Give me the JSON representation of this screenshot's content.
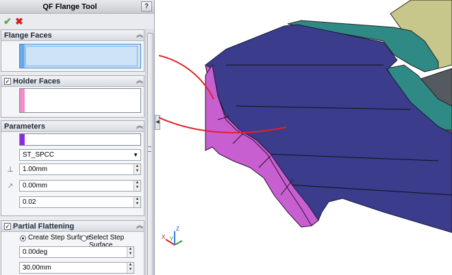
{
  "panel": {
    "title": "QF Flange Tool",
    "help_label": "?",
    "ok_icon": "checkmark-icon",
    "cancel_icon": "x-icon"
  },
  "groups": {
    "flange_faces": {
      "title": "Flange Faces",
      "swatch_color": "#6aa8e8",
      "selected": true
    },
    "holder_faces": {
      "title": "Holder Faces",
      "checked": true,
      "swatch_color": "#f08cc8"
    },
    "parameters": {
      "title": "Parameters",
      "color_swatch": "#8a2be2",
      "material": "ST_SPCC",
      "thickness": "1.00mm",
      "offset": "0.00mm",
      "k_factor": "0.02",
      "thickness_icon": "thickness-t1-icon",
      "offset_icon": "offset-arrow-icon"
    },
    "partial_flattening": {
      "title": "Partial Flattening",
      "checked": true,
      "option_create": "Create Step Surface",
      "option_select": "Select Step Surface",
      "selected_option": "create",
      "angle": "0.00deg",
      "distance": "30.00mm"
    }
  },
  "colors": {
    "part_face_top": "#3b3c8c",
    "part_face_pink": "#c75fd0",
    "part_face_teal": "#2f8a86",
    "part_face_olive": "#c7c78c",
    "selection_curve": "#e0232a"
  },
  "triad": {
    "x": "X",
    "y": "Y",
    "z": "Z"
  }
}
